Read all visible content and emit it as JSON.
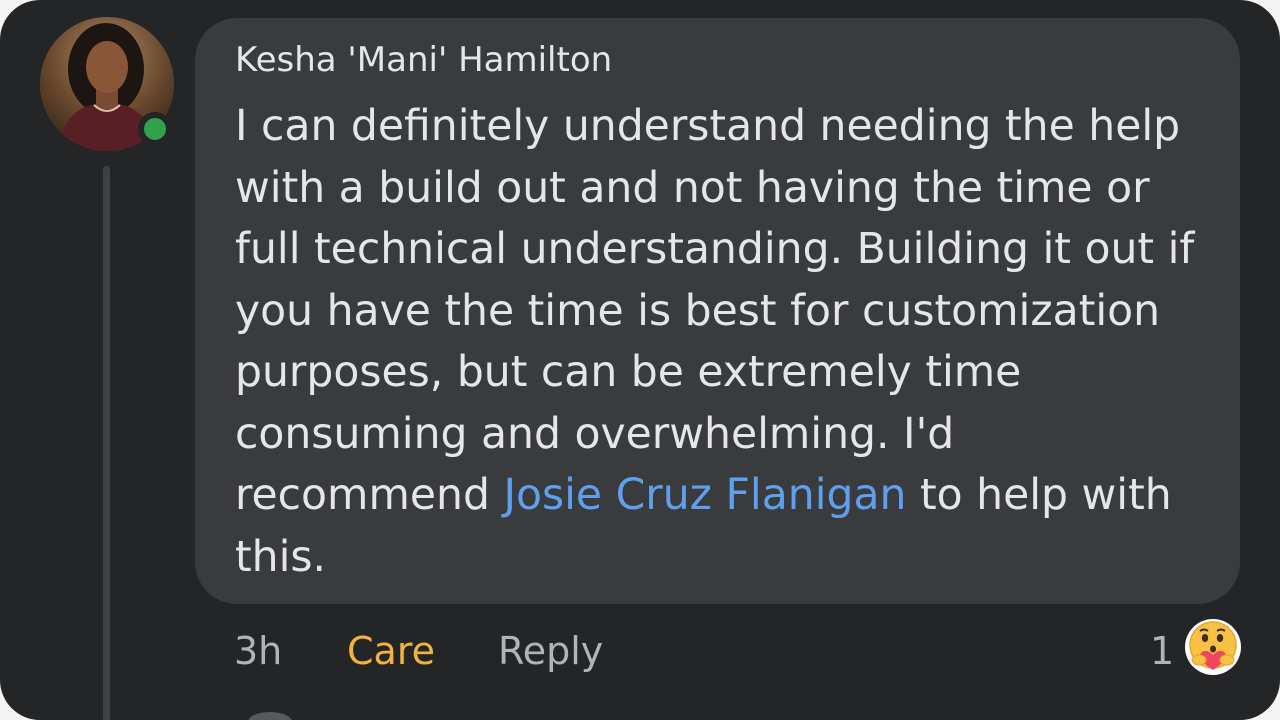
{
  "comment": {
    "author": "Kesha 'Mani' Hamilton",
    "text_before": "I can definitely understand needing the help with a build out and not having the time or full technical understanding. Building it out if you have the time is best for customization purposes, but can be extremely time consuming and overwhelming. I'd recommend ",
    "mention": "Josie Cruz Flanigan",
    "text_after": " to help with this.",
    "online": true
  },
  "actions": {
    "timestamp": "3h",
    "care_label": "Care",
    "reply_label": "Reply"
  },
  "reactions": {
    "count": "1",
    "icon": "care-reaction-icon"
  },
  "colors": {
    "background": "#242526",
    "bubble": "#3a3b3c",
    "text": "#e4e6eb",
    "secondary_text": "#b0b3b8",
    "mention": "#5ea0ef",
    "care": "#f2b43c",
    "online": "#31a24c"
  }
}
